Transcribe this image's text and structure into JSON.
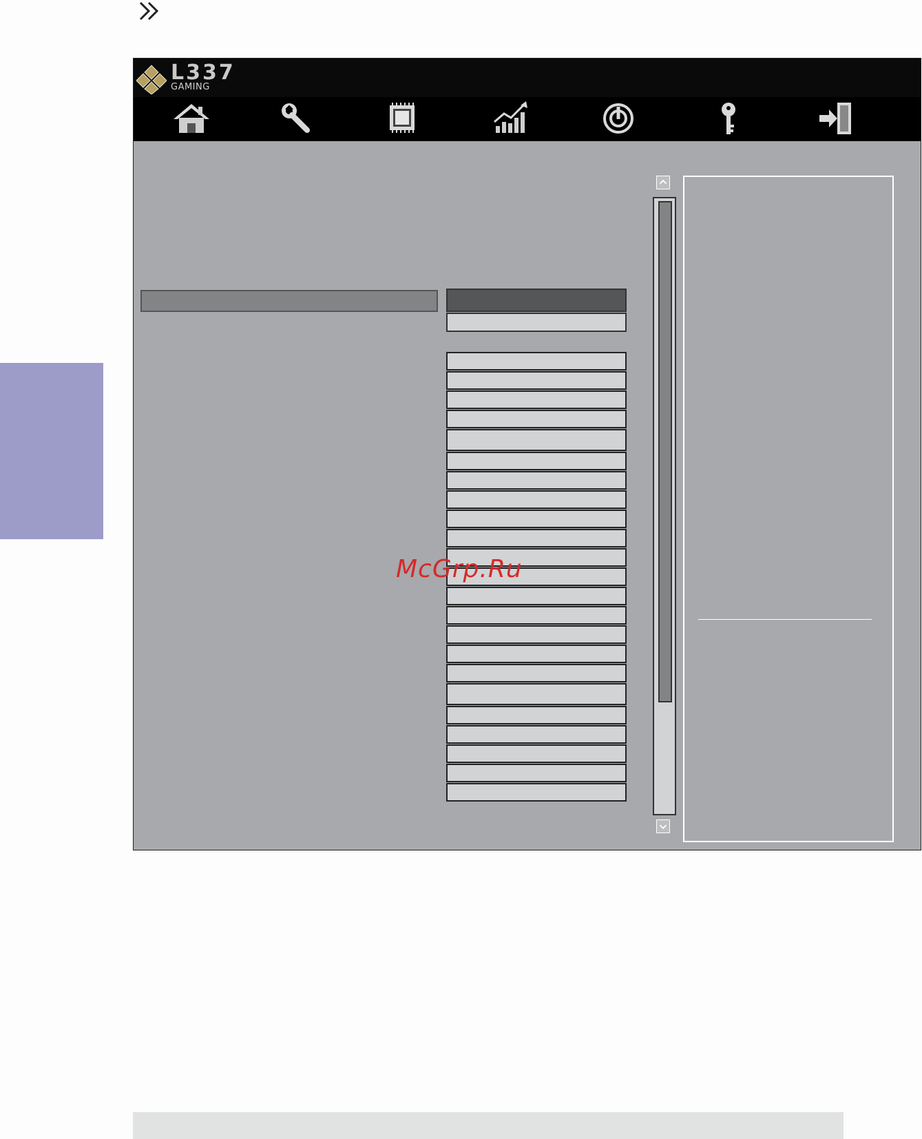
{
  "brand": {
    "logo_main": "L337",
    "logo_sub": "GAMING"
  },
  "nav": {
    "items": [
      {
        "icon": "home-icon"
      },
      {
        "icon": "wrench-icon"
      },
      {
        "icon": "chip-icon"
      },
      {
        "icon": "performance-chart-icon"
      },
      {
        "icon": "power-icon"
      },
      {
        "icon": "key-icon"
      },
      {
        "icon": "exit-icon"
      }
    ]
  },
  "list": {
    "row_count": 23
  },
  "watermark": "McGrp.Ru",
  "colors": {
    "panel_bg": "#a8a9ad",
    "header_bg": "#000000",
    "side_tab": "#9d9bc8",
    "row_bg": "#d2d3d5",
    "header_cell": "#555658",
    "watermark": "#d42a2a"
  }
}
